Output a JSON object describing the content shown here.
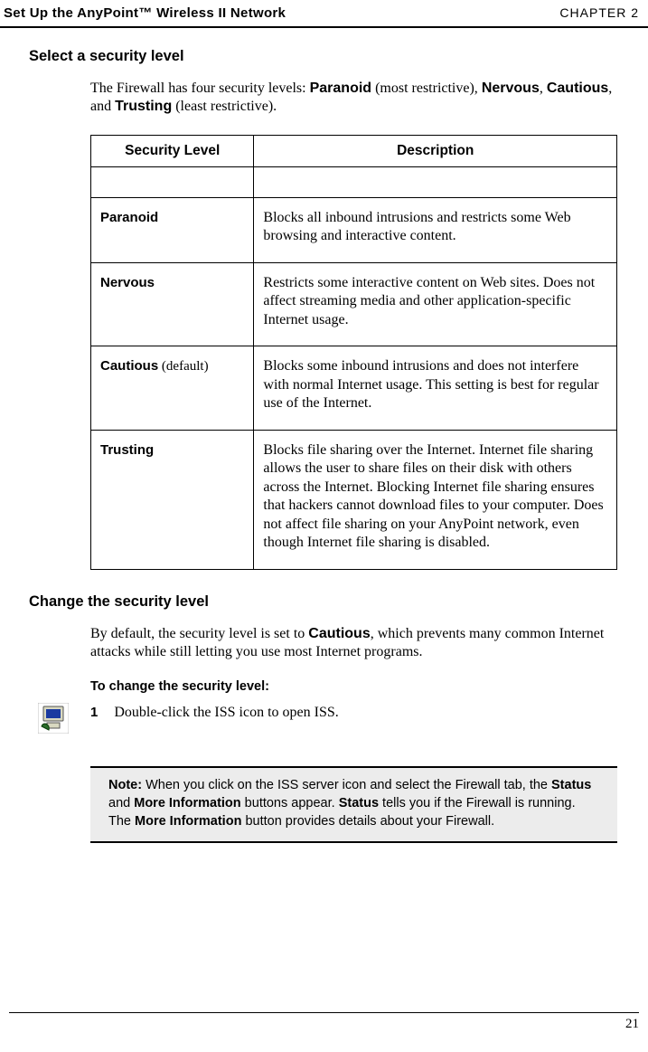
{
  "header": {
    "left": "Set Up the AnyPoint™ Wireless II Network",
    "right": "CHAPTER 2"
  },
  "section1": {
    "title": "Select a security level",
    "intro_pre": "The Firewall has four security levels: ",
    "level1": "Paranoid",
    "intro_mid1": " (most restrictive), ",
    "level2": "Nervous",
    "comma": ", ",
    "level3": "Cautious",
    "and": ", and ",
    "level4": "Trusting",
    "intro_post": " (least restrictive)."
  },
  "table": {
    "headers": {
      "col1": "Security Level",
      "col2": "Description"
    },
    "rows": [
      {
        "level_bold": "Paranoid",
        "level_extra": "",
        "desc": "Blocks all inbound intrusions and restricts some Web browsing and interactive content."
      },
      {
        "level_bold": "Nervous",
        "level_extra": "",
        "desc": "Restricts some interactive content on Web sites. Does not affect streaming media and other application-specific Internet usage."
      },
      {
        "level_bold": "Cautious",
        "level_extra": " (default)",
        "desc": "Blocks some inbound intrusions and does not interfere with normal Internet usage. This setting is best for regular use of the Internet."
      },
      {
        "level_bold": "Trusting",
        "level_extra": "",
        "desc": "Blocks file sharing over the Internet. Internet file sharing allows the user to share files on their disk with others across the Internet. Blocking Internet file sharing ensures that hackers cannot download files to your computer. Does not affect file sharing on your AnyPoint network, even though Internet file sharing is disabled."
      }
    ]
  },
  "section2": {
    "title": "Change the security level",
    "intro_pre": "By default, the security level is set to ",
    "bold1": "Cautious",
    "intro_post": ", which prevents many common Internet attacks while still letting you use most Internet programs.",
    "sub": "To change the security level:",
    "step_num": "1",
    "step_text": "Double-click the ISS icon to open ISS."
  },
  "note": {
    "label": "Note:  ",
    "part1": "When you click on the ISS server icon and select the Firewall tab, the ",
    "b1": "Status",
    "part2": " and ",
    "b2": "More Information",
    "part3": " buttons appear. ",
    "b3": "Status",
    "part4": " tells you if the Firewall is running. The ",
    "b4": "More Information",
    "part5": " button provides details about your Firewall."
  },
  "page_number": "21"
}
